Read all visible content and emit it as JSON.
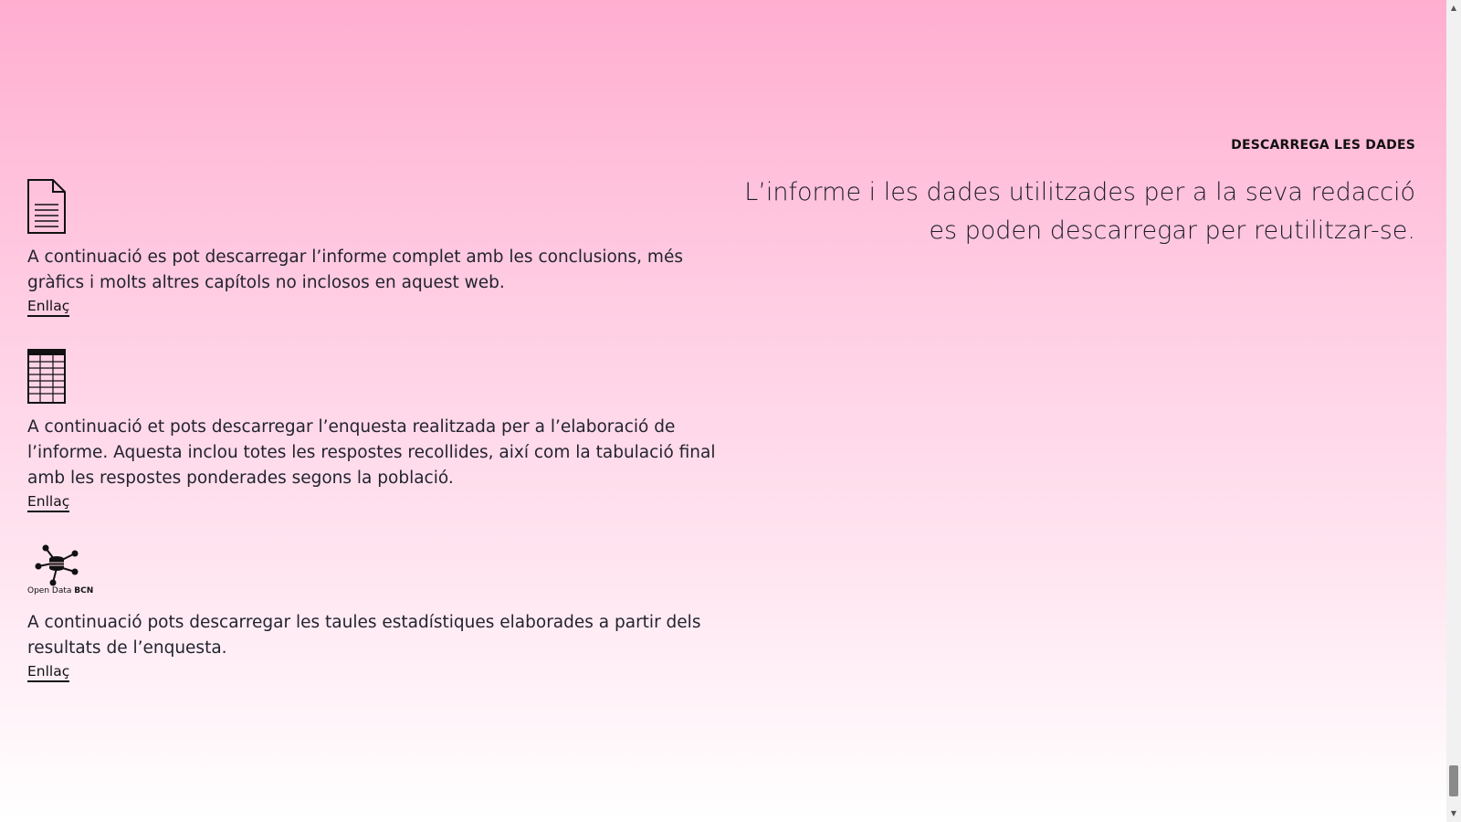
{
  "section": {
    "label": "DESCARREGA LES DADES",
    "intro": "L’informe i les dades utilitzades per a la seva redacció es poden descarregar per reutilitzar-se."
  },
  "downloads": [
    {
      "icon": "document-icon",
      "text": "A continuació es pot descarregar l’informe complet amb les conclusions, més gràfics i molts altres capítols no inclosos en aquest web.",
      "link": "Enllaç"
    },
    {
      "icon": "spreadsheet-icon",
      "text": "A continuació et pots descarregar l’enquesta realitzada per a l’elaboració de l’informe. Aquesta inclou totes les respostes recollides, així com la tabulació final amb les respostes ponderades segons la població.",
      "link": "Enllaç"
    },
    {
      "icon": "open-data-bcn-logo",
      "logo_text_a": "Open Data",
      "logo_text_b": "BCN",
      "text": "A continuació pots descarregar les taules estadístiques elaborades a partir dels resultats de l’enquesta.",
      "link": "Enllaç"
    }
  ],
  "colors": {
    "gradient_top": "#ffaed0",
    "gradient_bottom": "#ffffff",
    "text": "#23232f"
  },
  "scrollbar": {
    "up_arrow": "▲",
    "down_arrow": "▼"
  }
}
